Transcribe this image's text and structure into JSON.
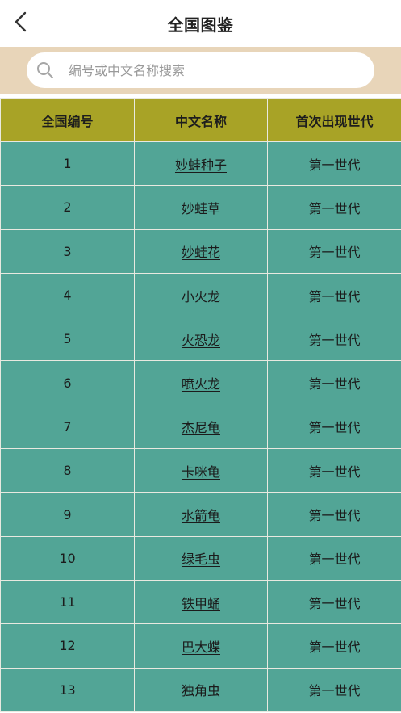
{
  "header": {
    "title": "全国图鉴",
    "back_icon": "chevron-left-icon"
  },
  "search": {
    "placeholder": "编号或中文名称搜索",
    "icon": "search-icon",
    "value": ""
  },
  "table": {
    "columns": [
      "全国编号",
      "中文名称",
      "首次出现世代"
    ],
    "rows": [
      {
        "number": "1",
        "name": "妙蛙种子",
        "generation": "第一世代"
      },
      {
        "number": "2",
        "name": "妙蛙草",
        "generation": "第一世代"
      },
      {
        "number": "3",
        "name": "妙蛙花",
        "generation": "第一世代"
      },
      {
        "number": "4",
        "name": "小火龙",
        "generation": "第一世代"
      },
      {
        "number": "5",
        "name": "火恐龙",
        "generation": "第一世代"
      },
      {
        "number": "6",
        "name": "喷火龙",
        "generation": "第一世代"
      },
      {
        "number": "7",
        "name": "杰尼龟",
        "generation": "第一世代"
      },
      {
        "number": "8",
        "name": "卡咪龟",
        "generation": "第一世代"
      },
      {
        "number": "9",
        "name": "水箭龟",
        "generation": "第一世代"
      },
      {
        "number": "10",
        "name": "绿毛虫",
        "generation": "第一世代"
      },
      {
        "number": "11",
        "name": "铁甲蛹",
        "generation": "第一世代"
      },
      {
        "number": "12",
        "name": "巴大蝶",
        "generation": "第一世代"
      },
      {
        "number": "13",
        "name": "独角虫",
        "generation": "第一世代"
      }
    ]
  },
  "colors": {
    "search_band": "#e8d5b9",
    "header_row": "#a8a326",
    "row_bg": "#52a596"
  }
}
